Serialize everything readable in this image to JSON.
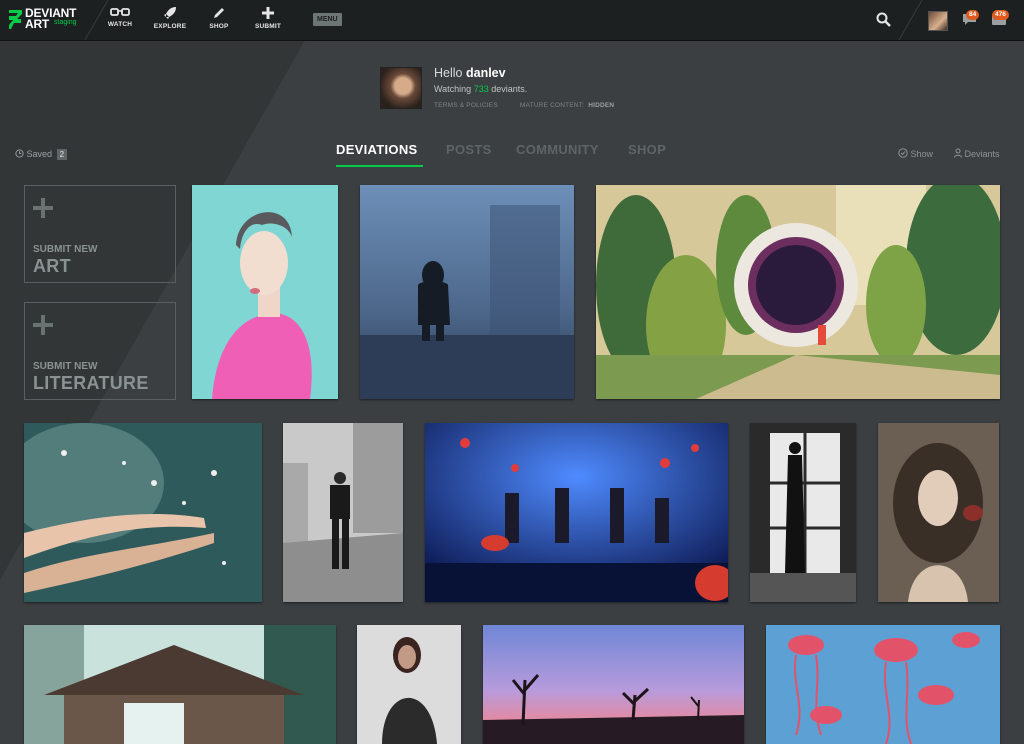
{
  "nav": {
    "logo_line1": "DEVIANT",
    "logo_line2": "ART",
    "logo_sub": "staging",
    "items": [
      {
        "label": "WATCH",
        "icon": "glasses-icon"
      },
      {
        "label": "EXPLORE",
        "icon": "rocket-icon"
      },
      {
        "label": "SHOP",
        "icon": "pencil-icon"
      },
      {
        "label": "SUBMIT",
        "icon": "plus-icon"
      }
    ],
    "menu_label": "MENU",
    "notifications": [
      {
        "icon": "message-icon",
        "count": "84"
      },
      {
        "icon": "inbox-icon",
        "count": "476"
      }
    ]
  },
  "profile": {
    "greeting": "Hello",
    "username": "danlev",
    "watching_prefix": "Watching",
    "watching_count": "733",
    "watching_suffix": "deviants.",
    "terms_label": "TERMS & POLICIES",
    "mature_label": "MATURE CONTENT:",
    "mature_value": "HIDDEN"
  },
  "saved": {
    "label": "Saved",
    "count": "2"
  },
  "tabs": [
    {
      "label": "DEVIATIONS",
      "active": true
    },
    {
      "label": "POSTS",
      "active": false
    },
    {
      "label": "COMMUNITY",
      "active": false
    },
    {
      "label": "SHOP",
      "active": false
    }
  ],
  "sort": {
    "show_label": "Show",
    "deviants_label": "Deviants"
  },
  "submit": [
    {
      "small": "SUBMIT NEW",
      "big": "ART"
    },
    {
      "small": "SUBMIT NEW",
      "big": "LITERATURE"
    }
  ],
  "colors": {
    "accent": "#05cc47",
    "nav_bg": "#1d2021",
    "page_bg": "#3b3f41",
    "badge": "#e05a1e"
  },
  "deviations": [
    {
      "name": "pink-sweater-portrait"
    },
    {
      "name": "hooded-figure-in-fog"
    },
    {
      "name": "stone-ring-portal-garden"
    },
    {
      "name": "hands-in-flowers"
    },
    {
      "name": "man-in-suit-street"
    },
    {
      "name": "robot-band-concert"
    },
    {
      "name": "woman-by-window"
    },
    {
      "name": "curly-hair-woman-portrait"
    },
    {
      "name": "japanese-gate-in-snow"
    },
    {
      "name": "armored-warrior-woman"
    },
    {
      "name": "joshua-trees-sunset"
    },
    {
      "name": "red-jellyfish"
    }
  ]
}
